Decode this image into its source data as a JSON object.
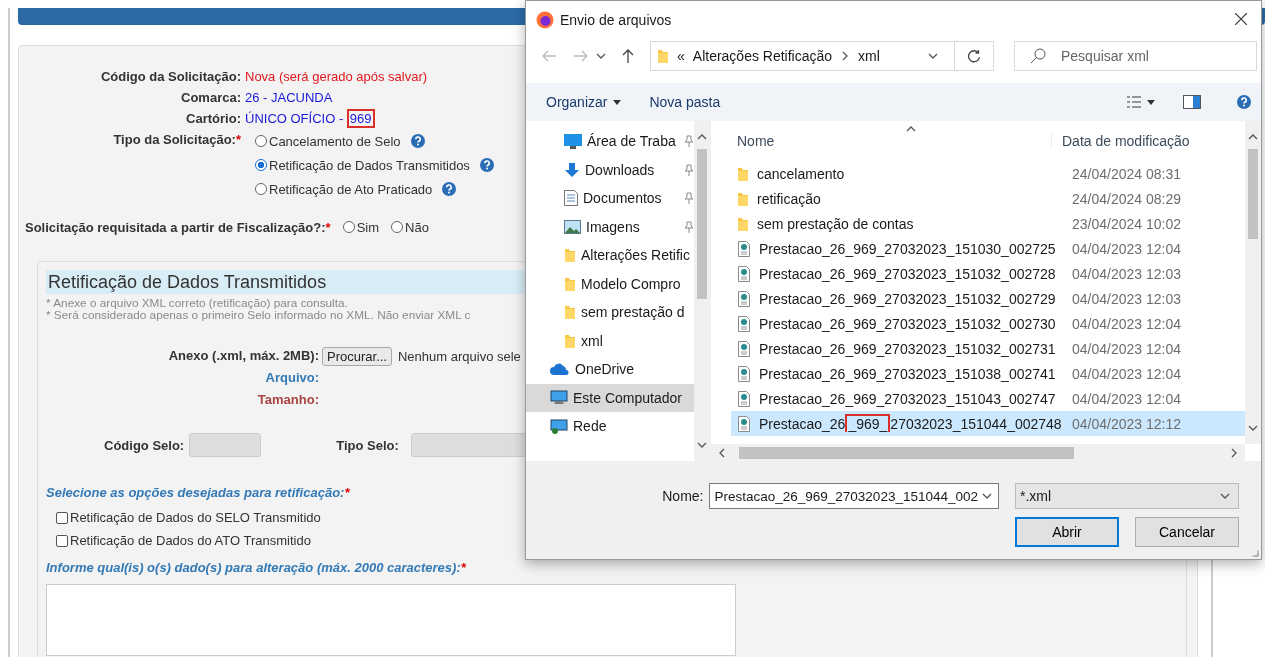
{
  "form": {
    "fields": [
      {
        "label": "Código da Solicitação:",
        "value": "Nova (será gerado após salvar)",
        "kind": "status"
      },
      {
        "label": "Comarca:",
        "value": "26 - JACUNDA",
        "kind": "link"
      },
      {
        "label": "Cartório:",
        "value": "ÚNICO OFÍCIO -",
        "highlight": "969",
        "kind": "link"
      }
    ],
    "request_type": {
      "label": "Tipo da Solicitação:",
      "required": "*",
      "options": [
        {
          "label": "Cancelamento de Selo",
          "selected": false
        },
        {
          "label": "Retificação de Dados Transmitidos",
          "selected": true
        },
        {
          "label": "Retificação de Ato Praticado",
          "selected": false
        }
      ]
    },
    "inspection": {
      "label": "Solicitação requisitada a partir de Fiscalização?:",
      "required": "*",
      "options": [
        {
          "label": "Sim",
          "selected": false
        },
        {
          "label": "Não",
          "selected": false
        }
      ]
    },
    "section": {
      "title": "Retificação de Dados Transmitidos",
      "notes": [
        "* Anexe o arquivo XML correto (retificação) para consulta.",
        "* Será considerado apenas o primeiro Selo informado no XML. Não enviar XML c"
      ],
      "attachment": {
        "label": "Anexo (.xml, máx. 2MB):",
        "button": "Procurar...",
        "status": "Nenhum arquivo sele"
      },
      "file_label": "Arquivo:",
      "size_label": "Tamanho:",
      "seal_code_label": "Código Selo:",
      "seal_type_label": "Tipo Selo:",
      "options_label": "Selecione as opções desejadas para retificação:",
      "options_required": "*",
      "checkboxes": [
        {
          "label": "Retificação de Dados do SELO Transmitido",
          "checked": false
        },
        {
          "label": "Retificação de Dados do ATO Transmitido",
          "checked": false
        }
      ],
      "details_label": "Informe qual(is) o(s) dado(s) para alteração (máx. 2000 caracteres):",
      "details_required": "*"
    }
  },
  "dialog": {
    "title": "Envio de arquivos",
    "path": {
      "overflow": "«",
      "segments": [
        "Alterações Retificação",
        "xml"
      ]
    },
    "search": {
      "placeholder": "Pesquisar xml"
    },
    "toolbar": {
      "organize": "Organizar",
      "new_folder": "Nova pasta"
    },
    "nav": {
      "quick_access": [
        {
          "label": "Área de Traba",
          "kind": "desktop",
          "pinned": true
        },
        {
          "label": "Downloads",
          "kind": "download",
          "pinned": true
        },
        {
          "label": "Documentos",
          "kind": "documents",
          "pinned": true
        },
        {
          "label": "Imagens",
          "kind": "images",
          "pinned": true
        },
        {
          "label": "Alterações Retific",
          "kind": "folder",
          "pinned": false
        },
        {
          "label": "Modelo Compro",
          "kind": "folder",
          "pinned": false
        },
        {
          "label": "sem prestação d",
          "kind": "folder",
          "pinned": false
        },
        {
          "label": "xml",
          "kind": "folder",
          "pinned": false
        }
      ],
      "locations": [
        {
          "label": "OneDrive",
          "kind": "cloud",
          "selected": false
        },
        {
          "label": "Este Computador",
          "kind": "computer",
          "selected": true
        },
        {
          "label": "Rede",
          "kind": "network",
          "selected": false
        }
      ]
    },
    "columns": [
      "Nome",
      "Data de modificação"
    ],
    "files": [
      {
        "name": "cancelamento",
        "kind": "folder",
        "date": "24/04/2024 08:31",
        "selected": false
      },
      {
        "name": "retificação",
        "kind": "folder",
        "date": "24/04/2024 08:29",
        "selected": false
      },
      {
        "name": "sem prestação de contas",
        "kind": "folder",
        "date": "23/04/2024 10:02",
        "selected": false
      },
      {
        "name": "Prestacao_26_969_27032023_151030_002725",
        "kind": "xml",
        "date": "04/04/2023 12:04",
        "selected": false
      },
      {
        "name": "Prestacao_26_969_27032023_151032_002728",
        "kind": "xml",
        "date": "04/04/2023 12:03",
        "selected": false
      },
      {
        "name": "Prestacao_26_969_27032023_151032_002729",
        "kind": "xml",
        "date": "04/04/2023 12:03",
        "selected": false
      },
      {
        "name": "Prestacao_26_969_27032023_151032_002730",
        "kind": "xml",
        "date": "04/04/2023 12:04",
        "selected": false
      },
      {
        "name": "Prestacao_26_969_27032023_151032_002731",
        "kind": "xml",
        "date": "04/04/2023 12:04",
        "selected": false
      },
      {
        "name": "Prestacao_26_969_27032023_151038_002741",
        "kind": "xml",
        "date": "04/04/2023 12:04",
        "selected": false
      },
      {
        "name": "Prestacao_26_969_27032023_151043_002747",
        "kind": "xml",
        "date": "04/04/2023 12:04",
        "selected": false
      },
      {
        "name": "Prestacao_26",
        "marked": "_969_",
        "name_rest": "27032023_151044_002748",
        "kind": "xml",
        "date": "04/04/2023 12:12",
        "selected": true
      }
    ],
    "filename": {
      "label": "Nome:",
      "value": "Prestacao_26_969_27032023_151044_002"
    },
    "filter": "*.xml",
    "buttons": [
      {
        "label": "Abrir",
        "kind": "primary"
      },
      {
        "label": "Cancelar",
        "kind": "secondary"
      }
    ]
  }
}
